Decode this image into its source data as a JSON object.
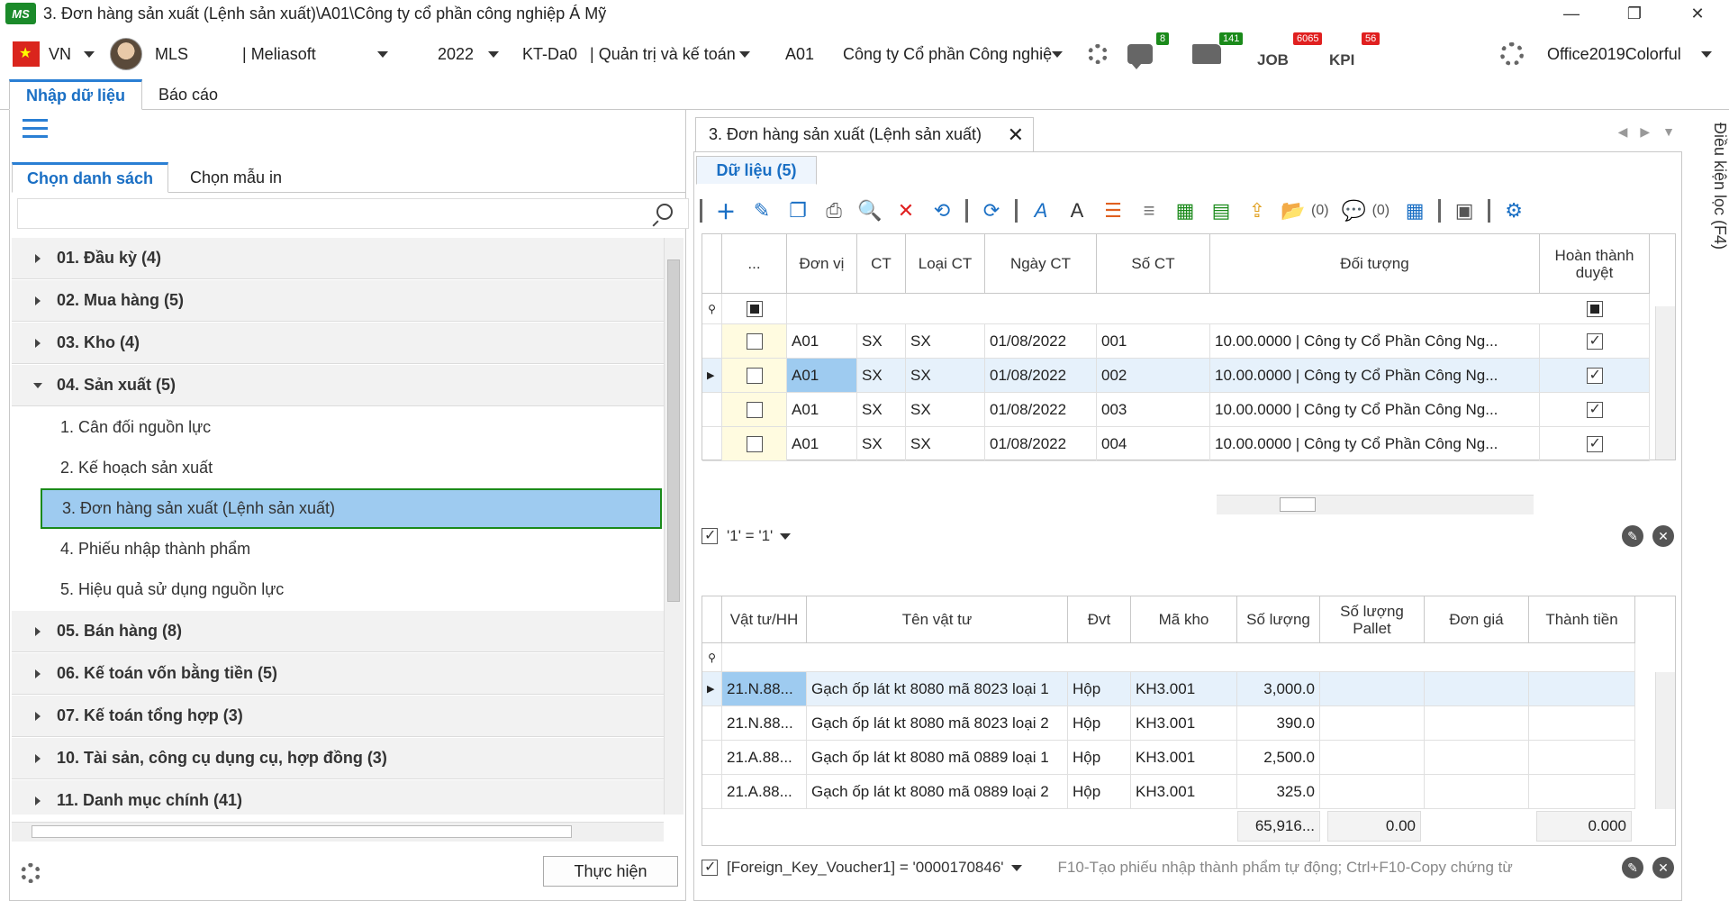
{
  "window": {
    "title": "3. Đơn hàng sản xuất (Lệnh sản xuất)\\A01\\Công ty cổ phần công nghiệp Á Mỹ",
    "logo": "MS",
    "minimize": "—",
    "maximize": "❐",
    "close": "✕"
  },
  "topbar": {
    "language": "VN",
    "user": "MLS",
    "company_name": "| Meliasoft",
    "year": "2022",
    "role": "KT-Da0",
    "role_desc": "| Quản trị và kế toán",
    "unit": "A01",
    "unit_name": "Công ty Cổ phần Công nghiệp",
    "chat_badge": "8",
    "folder_badge": "141",
    "job_label": "JOB",
    "job_badge": "6065",
    "kpi_label": "KPI",
    "kpi_badge": "56",
    "theme": "Office2019Colorful"
  },
  "main_tabs": [
    "Nhập dữ liệu",
    "Báo cáo"
  ],
  "left": {
    "sub_tabs": [
      "Chọn danh sách",
      "Chọn mẫu in"
    ],
    "search_value": "",
    "groups": [
      {
        "label": "01. Đầu kỳ (4)"
      },
      {
        "label": "02. Mua hàng (5)"
      },
      {
        "label": "03. Kho (4)"
      },
      {
        "label": "04. Sản xuất (5)"
      },
      {
        "label": "05. Bán hàng (8)"
      },
      {
        "label": "06. Kế toán vốn bằng tiền (5)"
      },
      {
        "label": "07. Kế toán tổng hợp (3)"
      },
      {
        "label": "10. Tài sản, công cụ dụng cụ, hợp đồng (3)"
      },
      {
        "label": "11. Danh mục chính (41)"
      }
    ],
    "items": [
      "1. Cân đối nguồn lực",
      "2. Kế hoạch sản xuất",
      "3. Đơn hàng sản xuất (Lệnh sản xuất)",
      "4. Phiếu nhập thành phẩm",
      "5. Hiệu quả sử dụng nguồn lực"
    ],
    "execute_button": "Thực hiện"
  },
  "right": {
    "doc_tab": "3. Đơn hàng sản xuất (Lệnh sản xuất)",
    "data_tab": "Dữ liệu (5)",
    "attach_count": "(0)",
    "comment_count": "(0)",
    "side_label": "Điều kiện lọc (F4)",
    "master": {
      "headers": [
        "...",
        "Đơn vị",
        "CT",
        "Loại CT",
        "Ngày CT",
        "Số CT",
        "Đối tượng",
        "Hoàn thành duyệt"
      ],
      "rows": [
        {
          "donvi": "A01",
          "ct": "SX",
          "loaict": "SX",
          "ngay": "01/08/2022",
          "so": "001",
          "doituong": "10.00.0000 | Công ty Cổ Phần Công Ng..."
        },
        {
          "donvi": "A01",
          "ct": "SX",
          "loaict": "SX",
          "ngay": "01/08/2022",
          "so": "002",
          "doituong": "10.00.0000 | Công ty Cổ Phần Công Ng..."
        },
        {
          "donvi": "A01",
          "ct": "SX",
          "loaict": "SX",
          "ngay": "01/08/2022",
          "so": "003",
          "doituong": "10.00.0000 | Công ty Cổ Phần Công Ng..."
        },
        {
          "donvi": "A01",
          "ct": "SX",
          "loaict": "SX",
          "ngay": "01/08/2022",
          "so": "004",
          "doituong": "10.00.0000 | Công ty Cổ Phần Công Ng..."
        }
      ],
      "filter": "'1' = '1'"
    },
    "detail": {
      "headers": [
        "Vật tư/HH",
        "Tên vật tư",
        "Đvt",
        "Mã kho",
        "Số lượng",
        "Số lượng Pallet",
        "Đơn giá",
        "Thành tiền"
      ],
      "rows": [
        {
          "vt": "21.N.88...",
          "ten": "Gạch ốp lát kt 8080 mã 8023 loại 1",
          "dvt": "Hộp",
          "kho": "KH3.001",
          "sl": "3,000.0"
        },
        {
          "vt": "21.N.88...",
          "ten": "Gạch ốp lát kt 8080 mã 8023 loại 2",
          "dvt": "Hộp",
          "kho": "KH3.001",
          "sl": "390.0"
        },
        {
          "vt": "21.A.88...",
          "ten": "Gạch ốp lát kt 8080 mã 0889 loại 1",
          "dvt": "Hộp",
          "kho": "KH3.001",
          "sl": "2,500.0"
        },
        {
          "vt": "21.A.88...",
          "ten": "Gạch ốp lát kt 8080 mã 0889 loại 2",
          "dvt": "Hộp",
          "kho": "KH3.001",
          "sl": "325.0"
        }
      ],
      "sum_sl": "65,916...",
      "sum_pallet": "0.00",
      "sum_tien": "0.000",
      "filter": "[Foreign_Key_Voucher1] = '0000170846'",
      "hint": "F10-Tạo phiếu nhập thành phẩm tự động; Ctrl+F10-Copy chứng từ"
    }
  }
}
